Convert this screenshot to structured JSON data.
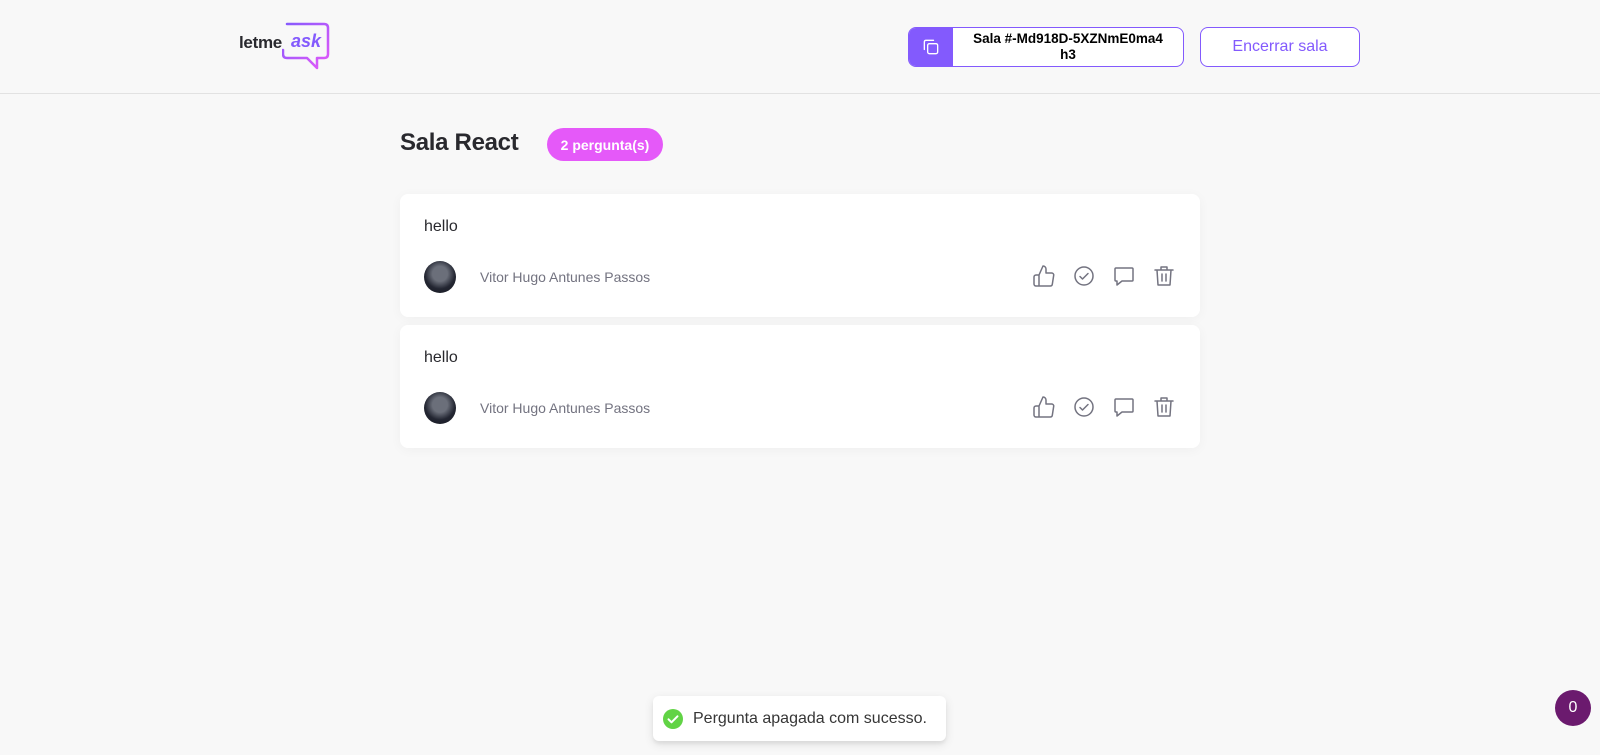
{
  "header": {
    "logo": {
      "prefix": "letme",
      "accent": "ask"
    },
    "room_code": "Sala #-Md918D-5XZNmE0ma4h3",
    "close_room_label": "Encerrar sala"
  },
  "room": {
    "title": "Sala React",
    "question_count_label": "2 pergunta(s)"
  },
  "questions": [
    {
      "text": "hello",
      "author": "Vitor Hugo Antunes Passos",
      "actions": [
        "like-icon",
        "check-circle-icon",
        "answer-icon",
        "delete-icon"
      ]
    },
    {
      "text": "hello",
      "author": "Vitor Hugo Antunes Passos",
      "actions": [
        "like-icon",
        "check-circle-icon",
        "answer-icon",
        "delete-icon"
      ]
    }
  ],
  "toast": {
    "message": "Pergunta apagada com sucesso.",
    "icon": "success-check-icon"
  },
  "floating_badge": {
    "count": "0"
  },
  "colors": {
    "brand_purple": "#835afd",
    "badge_pink": "#e559f9",
    "toast_success": "#61d345",
    "fab": "#6b1a6e",
    "background": "#f8f8f8"
  }
}
